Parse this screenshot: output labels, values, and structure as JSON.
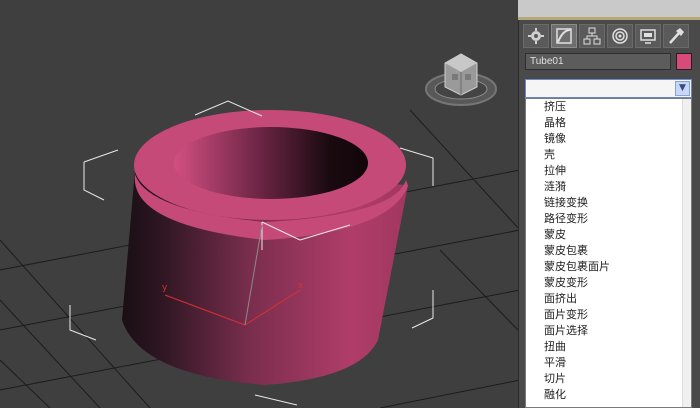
{
  "panel": {
    "tabs": [
      {
        "icon": "create-icon",
        "active": false
      },
      {
        "icon": "modify-icon",
        "active": true
      },
      {
        "icon": "hierarchy-icon",
        "active": false
      },
      {
        "icon": "motion-icon",
        "active": false
      },
      {
        "icon": "display-icon",
        "active": false
      },
      {
        "icon": "utilities-icon",
        "active": false
      }
    ],
    "object_name": "Tube01",
    "object_color": "#d84a7a",
    "modifier_list_value": "",
    "modifier_items": [
      "挤压",
      "晶格",
      "镜像",
      "壳",
      "拉伸",
      "涟漪",
      "链接变换",
      "路径变形",
      "蒙皮",
      "蒙皮包裹",
      "蒙皮包裹面片",
      "蒙皮变形",
      "面挤出",
      "面片变形",
      "面片选择",
      "扭曲",
      "平滑",
      "切片",
      "融化"
    ]
  },
  "viewport": {
    "axis_x_label": "x",
    "axis_y_label": "y",
    "object_color": "#c0406e",
    "viewcube_icon": "viewcube-icon"
  }
}
